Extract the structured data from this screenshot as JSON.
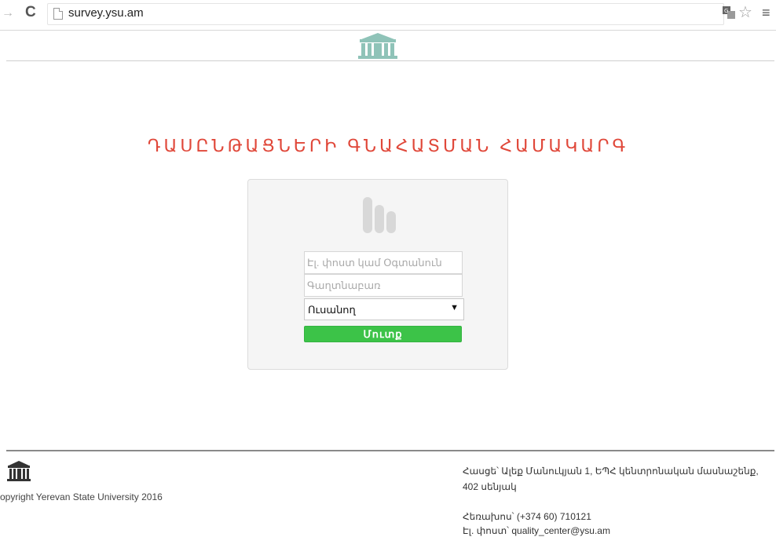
{
  "browser": {
    "url": "survey.ysu.am",
    "icons": [
      "forward-icon",
      "reload-icon",
      "page-icon",
      "translate-icon",
      "star-icon",
      "menu-icon"
    ]
  },
  "page": {
    "title": "ԴԱՍԸՆԹԱՑՆԵՐԻ ԳՆԱՀԱՏՄԱՆ ՀԱՄԱԿԱՐԳ"
  },
  "login": {
    "email_placeholder": "Էլ. փոստ կամ Օգտանուն",
    "password_placeholder": "Գաղտնաբառ",
    "role_selected": "Ուսանող",
    "submit_label": "Մուտք"
  },
  "footer": {
    "copyright": "opyright Yerevan State University 2016",
    "address_line1": "Հասցե՝ Ալեք Մանուկյան 1, ԵՊՀ կենտրոնական մասնաշենք,",
    "address_line2": "402 սենյակ",
    "phone": "Հեռախոս՝ (+374 60) 710121",
    "email": "Էլ. փոստ՝ quality_center@ysu.am"
  },
  "colors": {
    "title": "#e0483a",
    "button": "#3cc348",
    "logo": "#8fc3b8"
  }
}
